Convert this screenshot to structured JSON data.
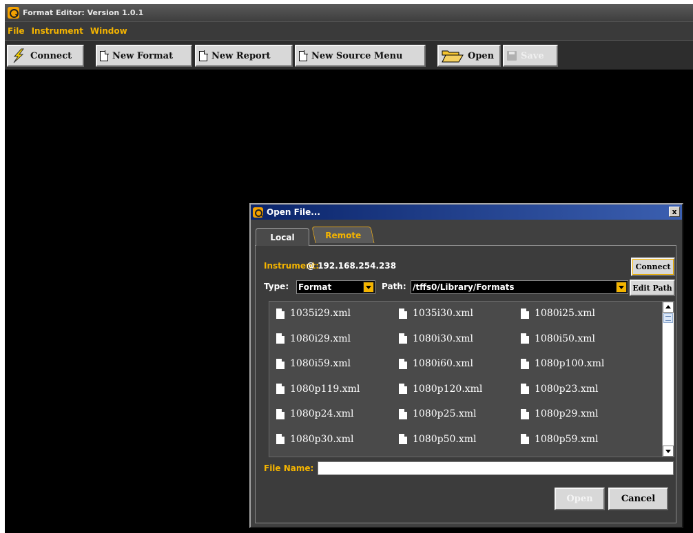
{
  "app": {
    "title": "Format Editor: Version 1.0.1"
  },
  "menu": {
    "items": [
      "File",
      "Instrument",
      "Window"
    ]
  },
  "toolbar": {
    "connect": "Connect",
    "new_format": "New Format",
    "new_report": "New Report",
    "new_source_menu": "New Source Menu",
    "open": "Open",
    "save": "Save"
  },
  "dialog": {
    "title": "Open File...",
    "close": "x",
    "tabs": [
      "Local",
      "Remote"
    ],
    "active_tab": "Local",
    "instrument_label": "Instrument:",
    "instrument_address": "@ 192.168.254.238",
    "connect": "Connect",
    "type_label": "Type:",
    "type_value": "Format",
    "path_label": "Path:",
    "path_value": "/tffs0/Library/Formats",
    "edit_path": "Edit Path",
    "files": [
      "1035i29.xml",
      "1035i30.xml",
      "1080i25.xml",
      "1080i29.xml",
      "1080i30.xml",
      "1080i50.xml",
      "1080i59.xml",
      "1080i60.xml",
      "1080p100.xml",
      "1080p119.xml",
      "1080p120.xml",
      "1080p23.xml",
      "1080p24.xml",
      "1080p25.xml",
      "1080p29.xml",
      "1080p30.xml",
      "1080p50.xml",
      "1080p59.xml"
    ],
    "file_name_label": "File Name:",
    "file_name_value": "",
    "open": "Open",
    "cancel": "Cancel"
  },
  "colors": {
    "accent": "#f4b400",
    "background": "#000000",
    "dialog_bg": "#404040",
    "title_gradient_start": "#0a246a"
  }
}
